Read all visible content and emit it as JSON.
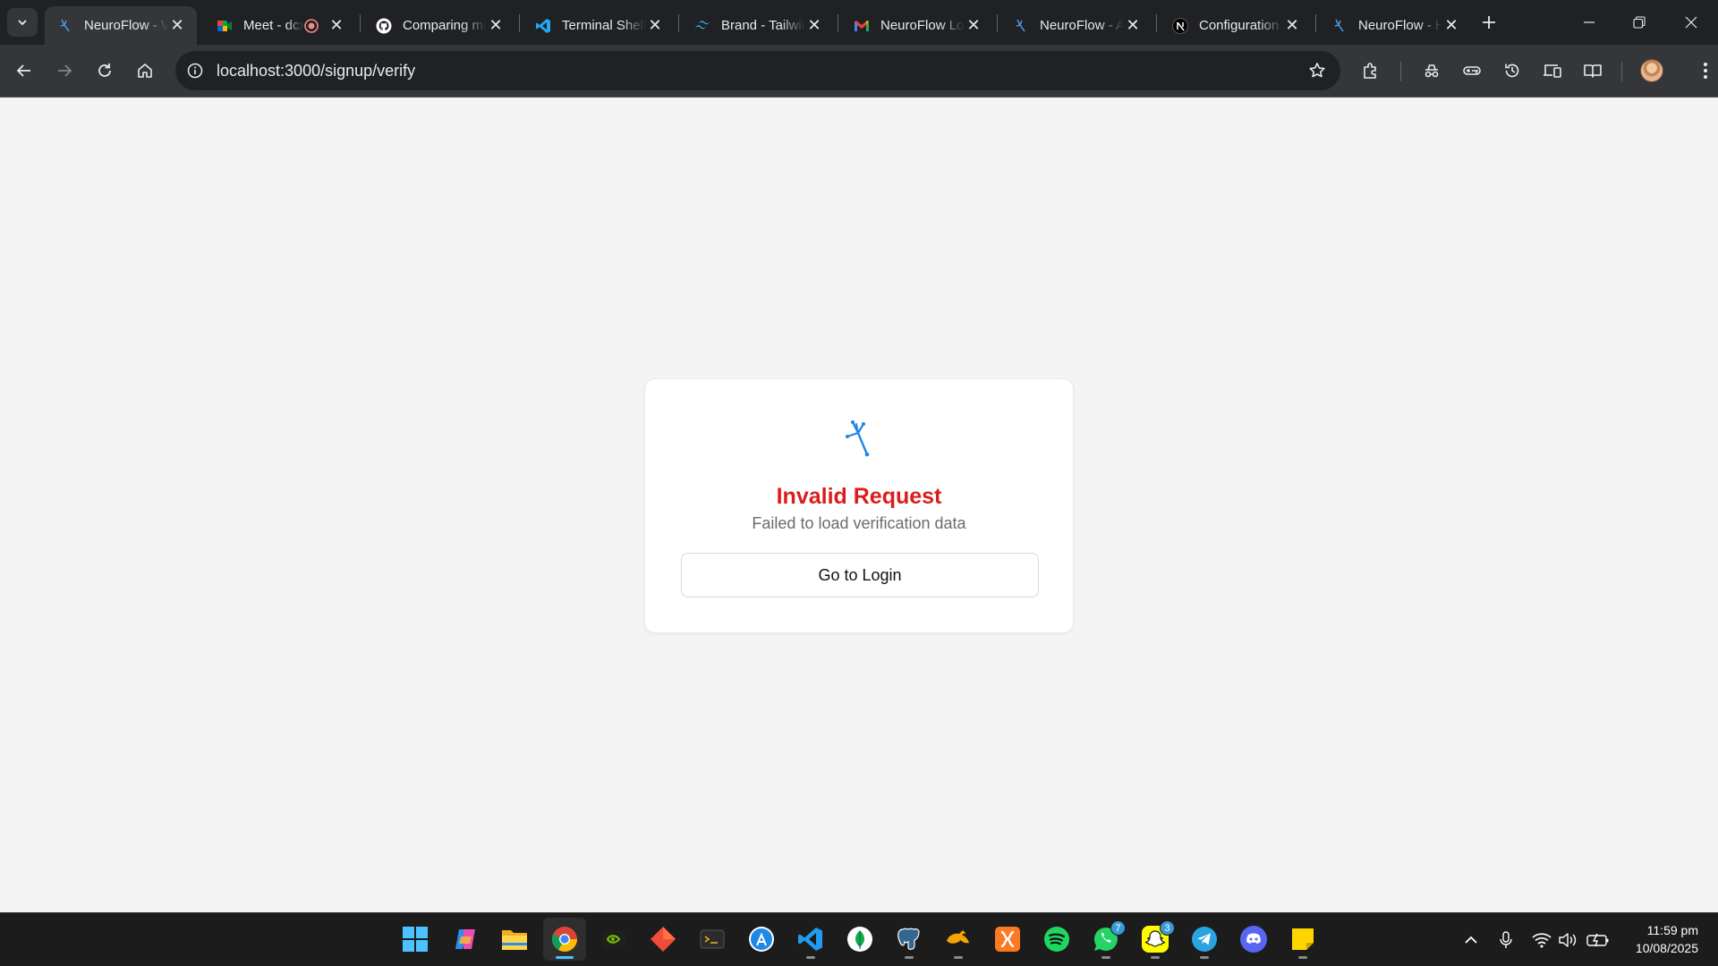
{
  "browser": {
    "tabs": [
      {
        "title": "NeuroFlow - Verify",
        "favicon": "neuroflow-icon",
        "active": true
      },
      {
        "title": "Meet - dcx-qwer-tyu",
        "favicon": "google-meet-icon",
        "recording": true
      },
      {
        "title": "Comparing main...",
        "favicon": "github-icon"
      },
      {
        "title": "Terminal Shell Integration",
        "favicon": "vscode-icon"
      },
      {
        "title": "Brand - Tailwind CSS",
        "favicon": "tailwind-icon"
      },
      {
        "title": "NeuroFlow Login",
        "favicon": "gmail-icon"
      },
      {
        "title": "NeuroFlow - App",
        "favicon": "neuroflow-icon"
      },
      {
        "title": "Configuration",
        "favicon": "nextjs-icon"
      },
      {
        "title": "NeuroFlow - Home",
        "favicon": "neuroflow-icon"
      }
    ],
    "url": "localhost:3000/signup/verify"
  },
  "page": {
    "title": "Invalid Request",
    "subtitle": "Failed to load verification data",
    "button_label": "Go to Login"
  },
  "colors": {
    "error": "#dc1d1d",
    "logo": "#1e88e5",
    "page_bg": "#f4f4f4"
  },
  "taskbar": {
    "apps": [
      {
        "name": "start-icon"
      },
      {
        "name": "copilot-icon"
      },
      {
        "name": "file-explorer-icon"
      },
      {
        "name": "chrome-icon",
        "active": true
      },
      {
        "name": "nvidia-icon"
      },
      {
        "name": "git-kraken-icon"
      },
      {
        "name": "terminal-icon"
      },
      {
        "name": "app-store-icon"
      },
      {
        "name": "vscode-icon",
        "running": true
      },
      {
        "name": "mongodb-icon"
      },
      {
        "name": "postgresql-icon",
        "running": true
      },
      {
        "name": "docker-like-icon",
        "running": true
      },
      {
        "name": "xampp-icon"
      },
      {
        "name": "spotify-icon"
      },
      {
        "name": "whatsapp-icon",
        "badge": "7",
        "running": true
      },
      {
        "name": "snapchat-icon",
        "badge": "3",
        "running": true
      },
      {
        "name": "telegram-icon",
        "running": true
      },
      {
        "name": "discord-icon"
      },
      {
        "name": "sticky-notes-icon",
        "running": true
      }
    ],
    "time": "11:59 pm",
    "date": "10/08/2025"
  }
}
